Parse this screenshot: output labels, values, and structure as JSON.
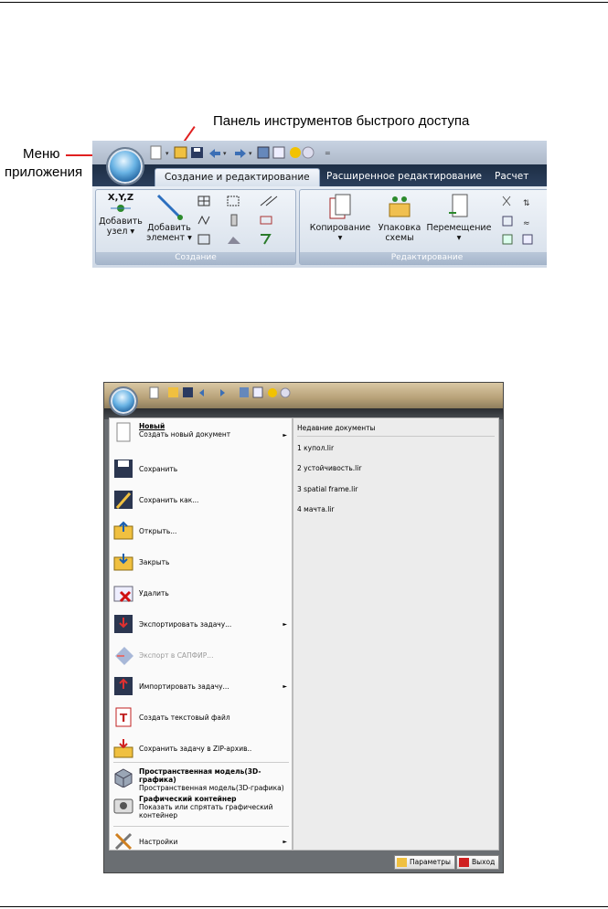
{
  "annotations": {
    "qat_label": "Панель инструментов быстрого доступа",
    "menu_label_1": "Меню",
    "menu_label_2": "приложения"
  },
  "ribbon": {
    "tabs": [
      "Создание и редактирование",
      "Расширенное редактирование",
      "Расчет"
    ],
    "group1": {
      "label": "Создание",
      "add_node_1": "Добавить",
      "add_node_2": "узел",
      "add_elem_1": "Добавить",
      "add_elem_2": "элемент"
    },
    "group2": {
      "label": "Редактирование",
      "copy": "Копирование",
      "pack_1": "Упаковка",
      "pack_2": "схемы",
      "move": "Перемещение"
    },
    "xyz": "X,Y,Z"
  },
  "menu": {
    "items": [
      {
        "title": "Новый",
        "subtitle": "Создать новый документ",
        "submenu": true
      },
      {
        "title": "Сохранить"
      },
      {
        "title": "Сохранить как..."
      },
      {
        "title": "Открыть..."
      },
      {
        "title": "Закрыть"
      },
      {
        "title": "Удалить"
      },
      {
        "title": "Экспортировать задачу...",
        "submenu": true
      },
      {
        "title": "Экспорт в САПФИР...",
        "disabled": true
      },
      {
        "title": "Импортировать задачу...",
        "submenu": true
      },
      {
        "title": "Создать текстовый файл"
      },
      {
        "title": "Сохранить задачу в ZIP-архив.."
      },
      {
        "title": "Пространственная модель(3D-графика)",
        "subtitle": "Пространственная модель(3D-графика)"
      },
      {
        "title": "Графический контейнер",
        "subtitle": "Показать или спрятать графический контейнер"
      },
      {
        "title": "Настройки",
        "submenu": true
      }
    ],
    "recent_header": "Недавние документы",
    "recent": [
      "1 купол.lir",
      "2 устойчивость.lir",
      "3 spatial frame.lir",
      "4 мачта.lir"
    ],
    "params_button": "Параметры",
    "exit_button": "Выход",
    "arrow": "►"
  },
  "colors": {
    "accent_red": "#e02020",
    "ribbon_dark": "#1d2e45"
  }
}
